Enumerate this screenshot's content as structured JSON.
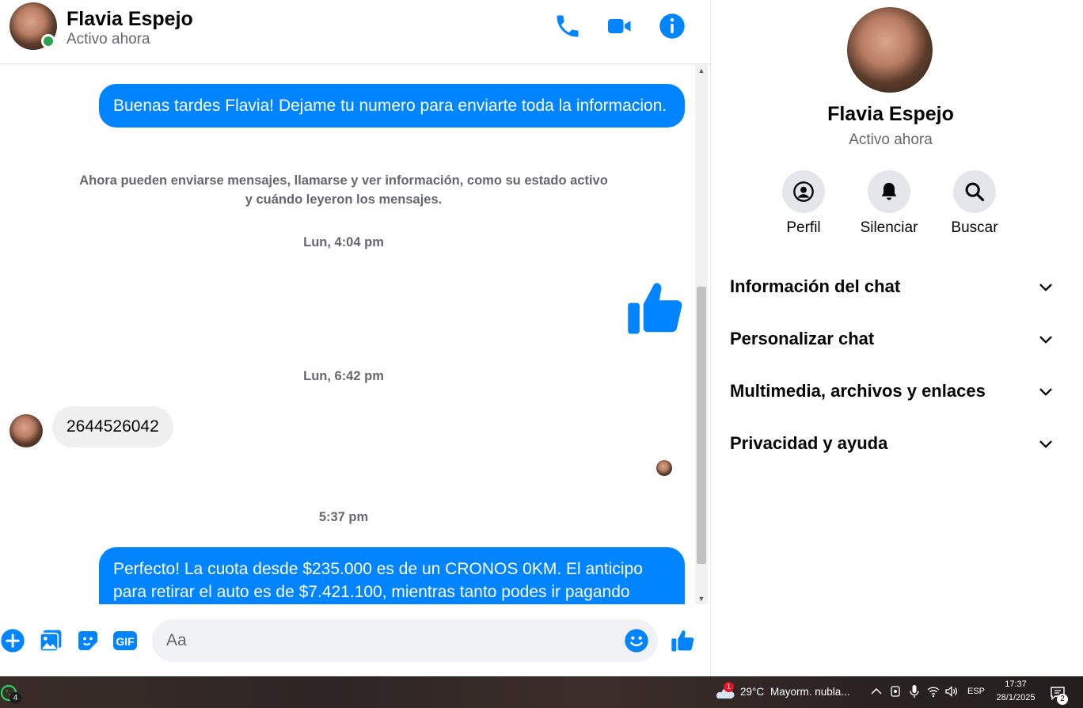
{
  "header": {
    "name": "Flavia Espejo",
    "status": "Activo ahora",
    "call_icon": "phone-icon",
    "video_icon": "video-camera-icon",
    "info_icon": "info-icon"
  },
  "messages": {
    "out1": "Buenas tardes Flavia! Dejame tu numero para enviarte toda la informacion.",
    "info": "Ahora pueden enviarse mensajes, llamarse y ver información, como su estado activo y cuándo leyeron los mensajes.",
    "time1": "Lun, 4:04 pm",
    "like_icon": "thumbs-up-icon",
    "time2": "Lun, 6:42 pm",
    "in1": "2644526042",
    "time3": "5:37 pm",
    "out2": "Perfecto! La cuota desde $235.000 es de un CRONOS 0KM. El anticipo para retirar el auto es de $7.421.100, mientras tanto podes ir pagando"
  },
  "composer": {
    "placeholder": "Aa",
    "icons": [
      "plus-circle-icon",
      "image-icon",
      "sticker-icon",
      "gif-icon",
      "emoji-icon",
      "thumbs-up-icon"
    ],
    "gif_label": "GIF"
  },
  "panel": {
    "name": "Flavia Espejo",
    "status": "Activo ahora",
    "actions": [
      {
        "label": "Perfil",
        "icon": "profile-icon"
      },
      {
        "label": "Silenciar",
        "icon": "bell-icon"
      },
      {
        "label": "Buscar",
        "icon": "search-icon"
      }
    ],
    "sections": [
      "Información del chat",
      "Personalizar chat",
      "Multimedia, archivos y enlaces",
      "Privacidad y ayuda"
    ]
  },
  "taskbar": {
    "app_badge": "4",
    "weather_badge": "1",
    "temperature": "29°C",
    "weather": "Mayorm. nubla...",
    "language": "ESP",
    "time": "17:37",
    "date": "28/1/2025",
    "notifications": "2"
  },
  "colors": {
    "messenger_blue": "#0084ff",
    "online_green": "#31a24c",
    "muted_text": "#65676b"
  }
}
